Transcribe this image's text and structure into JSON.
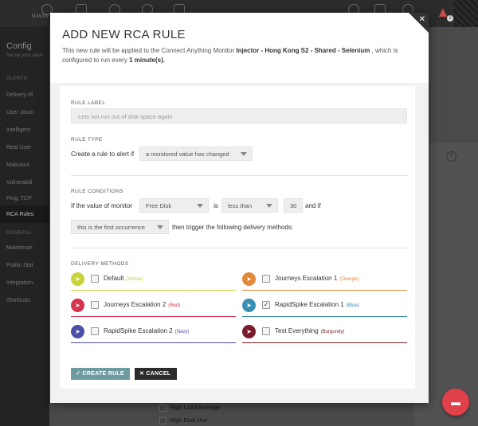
{
  "app": {
    "nav_label": "NAVIG",
    "badge": "2",
    "sidebar": {
      "title": "Config",
      "subtitle": "Set up your dash",
      "alerts_heading": "ALERTS",
      "alerts_items": [
        "Delivery M",
        "User Journ",
        "Intelligent",
        "Real User",
        "Malicious",
        "Vulnerabili",
        "Ping, TCP",
        "RCA Rules"
      ],
      "general_heading": "GENERAL",
      "general_items": [
        "Maintenan",
        "Public Stat",
        "Integration",
        "Shortcuts"
      ]
    },
    "background_checks": [
      "High Load Average",
      "High Disk Use"
    ],
    "help_glyph": "?"
  },
  "modal": {
    "title": "ADD NEW RCA RULE",
    "desc_prefix": "This new rule will be applied to the Connect Anything Monitor",
    "monitor_name": "Injector - Hong Kong S2 - Shared - Selenium",
    "desc_middle": ", which is configured to run every",
    "interval": "1 minute(s).",
    "close_glyph": "✕",
    "rule_label_heading": "RULE LABEL",
    "rule_label_placeholder": "Lets not run out of disk space again",
    "rule_type_heading": "RULE TYPE",
    "rule_type_prefix": "Create a rule to alert if",
    "rule_type_value": "a monitored value has changed",
    "conditions_heading": "RULE CONDITIONS",
    "cond_prefix": "If the value of monitor",
    "cond_metric": "Free Disk",
    "cond_is": "is",
    "cond_operator": "less than",
    "cond_value": "30",
    "cond_and_if": "and if",
    "cond_occurrence": "this is the first occurrence",
    "cond_suffix": "then trigger the following delivery methods:",
    "delivery_heading": "DELIVERY METHODS",
    "delivery_methods": [
      {
        "name": "Default",
        "color_name": "(Yellow)",
        "color": "#c8d43a",
        "checked": false
      },
      {
        "name": "Journeys Escalation 1",
        "color_name": "(Orange)",
        "color": "#e0893a",
        "checked": false
      },
      {
        "name": "Journeys Escalation 2",
        "color_name": "(Red)",
        "color": "#d6334f",
        "checked": false
      },
      {
        "name": "RapidSpike Escalation 1",
        "color_name": "(Blue)",
        "color": "#3b8fb3",
        "checked": true
      },
      {
        "name": "RapidSpike Escalation 2",
        "color_name": "(Navy)",
        "color": "#4b4fa6",
        "checked": false
      },
      {
        "name": "Test Everything",
        "color_name": "(Burgundy)",
        "color": "#7a1c2b",
        "checked": false
      }
    ],
    "create_label": "CREATE RULE",
    "cancel_label": "CANCEL",
    "create_glyph": "✓",
    "cancel_glyph": "✕"
  }
}
